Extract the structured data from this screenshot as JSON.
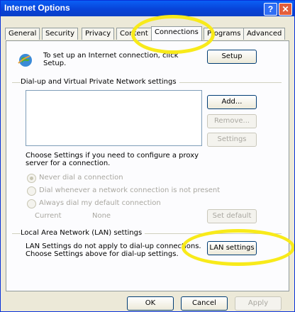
{
  "window": {
    "title": "Internet Options"
  },
  "tabs": [
    "General",
    "Security",
    "Privacy",
    "Content",
    "Connections",
    "Programs",
    "Advanced"
  ],
  "setup": {
    "text": [
      "To set up an Internet connection, click",
      "Setup."
    ],
    "button": "Setup"
  },
  "dialup": {
    "group_title": "Dial-up and Virtual Private Network settings",
    "add": "Add...",
    "remove": "Remove...",
    "settings": "Settings",
    "choose_text": [
      "Choose Settings if you need to configure a proxy",
      "server for a connection."
    ],
    "options": [
      "Never dial a connection",
      "Dial whenever a network connection is not present",
      "Always dial my default connection"
    ],
    "current_label": "Current",
    "current_value": "None",
    "set_default": "Set default"
  },
  "lan": {
    "group_title": "Local Area Network (LAN) settings",
    "text": [
      "LAN Settings do not apply to dial-up connections.",
      "Choose Settings above for dial-up settings."
    ],
    "button": "LAN settings"
  },
  "footer": {
    "ok": "OK",
    "cancel": "Cancel",
    "apply": "Apply"
  },
  "colors": {
    "highlight": "#f8ea1a",
    "titlebar": "#0a5ff5"
  }
}
